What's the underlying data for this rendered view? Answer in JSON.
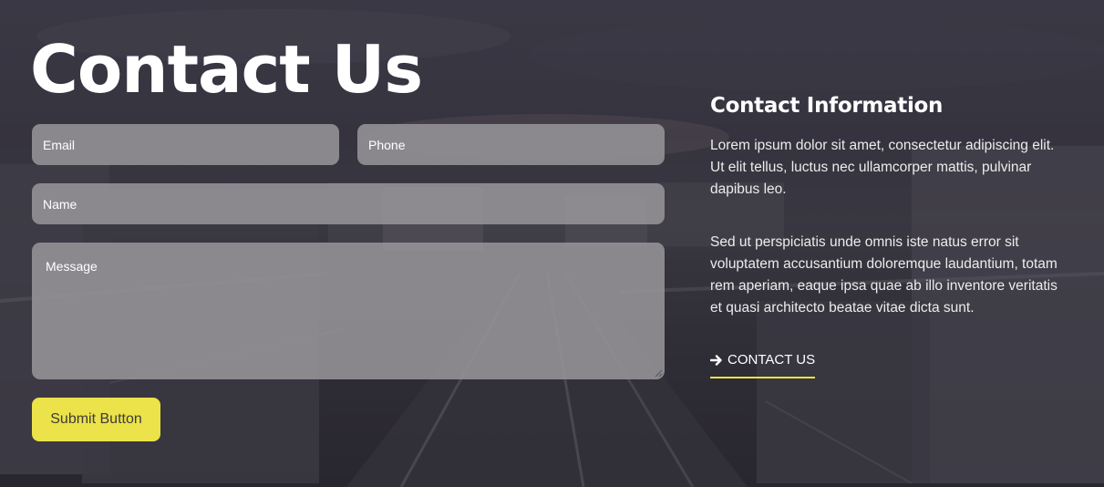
{
  "page": {
    "title": "Contact Us"
  },
  "form": {
    "email_placeholder": "Email",
    "phone_placeholder": "Phone",
    "name_placeholder": "Name",
    "message_placeholder": "Message",
    "submit_label": "Submit Button"
  },
  "contact_info": {
    "title": "Contact Information",
    "paragraph_1": "Lorem ipsum dolor sit amet, consectetur adipiscing elit. Ut elit tellus, luctus nec ullamcorper mattis, pulvinar dapibus leo.",
    "paragraph_2": "Sed ut perspiciatis unde omnis iste natus error sit voluptatem accusantium doloremque laudantium, totam rem aperiam, eaque ipsa quae ab illo inventore veritatis et quasi architecto beatae vitae dicta sunt.",
    "link_label": "CONTACT US",
    "link_icon": "arrow-right-icon"
  },
  "colors": {
    "accent": "#ece249",
    "field_background": "#969498",
    "overlay": "#23212a"
  }
}
